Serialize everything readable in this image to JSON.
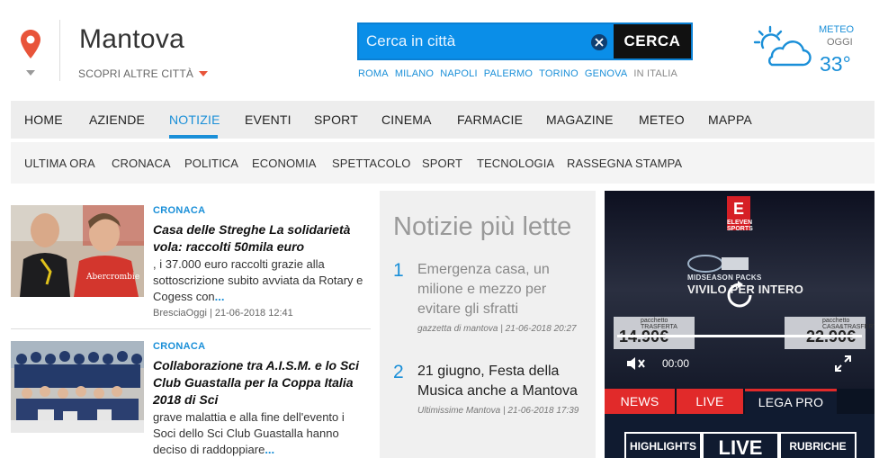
{
  "header": {
    "city": "Mantova",
    "other_cities": "SCOPRI ALTRE CITTÀ",
    "search": {
      "placeholder": "Cerca in città",
      "button": "CERCA"
    },
    "quick_cities": [
      "ROMA",
      "MILANO",
      "NAPOLI",
      "PALERMO",
      "TORINO",
      "GENOVA",
      "IN ITALIA"
    ],
    "weather": {
      "label": "METEO",
      "sub": "OGGI",
      "temp": "33°",
      "icon": "partly-cloudy-icon"
    }
  },
  "main_nav": [
    "HOME",
    "AZIENDE",
    "NOTIZIE",
    "EVENTI",
    "SPORT",
    "CINEMA",
    "FARMACIE",
    "MAGAZINE",
    "METEO",
    "MAPPA"
  ],
  "main_nav_active": "NOTIZIE",
  "sub_nav": [
    "ULTIMA ORA",
    "CRONACA",
    "POLITICA",
    "ECONOMIA",
    "SPETTACOLO",
    "SPORT",
    "TECNOLOGIA",
    "RASSEGNA STAMPA"
  ],
  "articles": [
    {
      "category": "CRONACA",
      "title": "Casa delle Streghe La solidarietà vola: raccolti 50mila euro",
      "summary": ", i 37.000 euro raccolti grazie alla sottoscrizione subito avviata da Rotary e Cogess con",
      "more": "...",
      "source": "BresciaOggi",
      "date": "21-06-2018 12:41"
    },
    {
      "category": "CRONACA",
      "title": "Collaborazione tra A.I.S.M. e lo Sci Club Guastalla per la Coppa Italia 2018 di Sci",
      "summary": "grave malattia e alla fine dell'evento i Soci dello Sci Club Guastalla hanno deciso di raddoppiare",
      "more": "..."
    }
  ],
  "most_read": {
    "title": "Notizie più lette",
    "items": [
      {
        "num": "1",
        "headline": "Emergenza casa, un milione e mezzo per evitare gli sfratti",
        "source": "gazzetta di mantova | 21-06-2018 20:27"
      },
      {
        "num": "2",
        "headline": "21 giugno, Festa della Musica anche a Mantova",
        "source": "Ultimissime Mantova | 21-06-2018 17:39"
      }
    ]
  },
  "video": {
    "channel_text": "ELEVEN SPORTS",
    "overlay_line1": "MIDSEASON PACKS",
    "overlay_line2": "VIVILO PER INTERO",
    "left_label": "pacchetto TRASFERTA",
    "left_price": "14.90€",
    "right_label": "pacchetto CASA&TRASFERTA",
    "right_price": "22.90€",
    "time": "00:00",
    "tabs": [
      "NEWS",
      "LIVE",
      "LEGA PRO"
    ],
    "sub_tabs": [
      "HIGHLIGHTS",
      "LIVE",
      "RUBRICHE"
    ]
  }
}
